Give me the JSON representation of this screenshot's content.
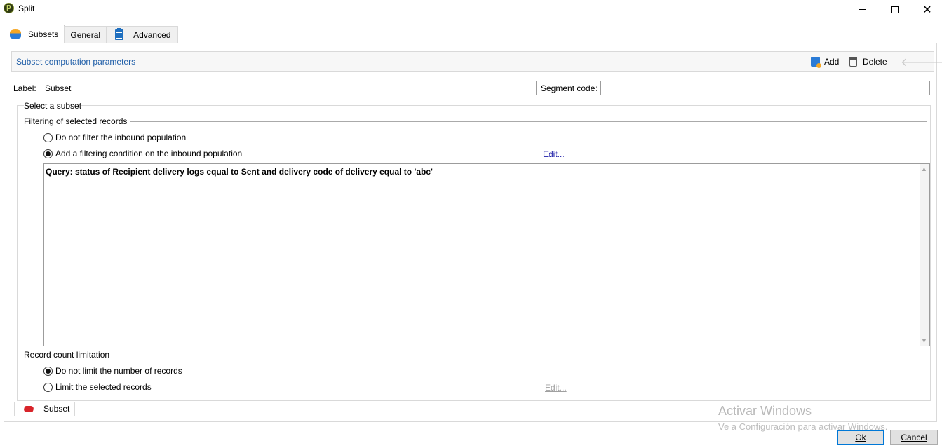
{
  "window": {
    "title": "Split"
  },
  "tabs": [
    {
      "label": "Subsets",
      "icon": "database-icon",
      "active": true
    },
    {
      "label": "General",
      "icon": "",
      "active": false
    },
    {
      "label": "Advanced",
      "icon": "clipboard-icon",
      "active": false
    }
  ],
  "section": {
    "title": "Subset computation parameters",
    "toolbar": {
      "add_label": "Add",
      "delete_label": "Delete"
    }
  },
  "form": {
    "label_caption": "Label:",
    "label_value": "Subset",
    "segment_caption": "Segment code:",
    "segment_value": ""
  },
  "select_subset": {
    "title": "Select a subset",
    "filtering": {
      "title": "Filtering of selected records",
      "option_no_filter": "Do not filter the inbound population",
      "option_add_condition": "Add a filtering condition on the inbound population",
      "selected": "add_condition",
      "edit_link": "Edit...",
      "query": "Query: status of Recipient delivery logs equal to Sent and delivery code of delivery equal to 'abc'"
    },
    "limitation": {
      "title": "Record count limitation",
      "option_no_limit": "Do not limit the number of records",
      "option_limit": "Limit the selected records",
      "selected": "no_limit",
      "edit_link": "Edit..."
    }
  },
  "bottom_tab": {
    "label": "Subset",
    "icon": "eraser-icon"
  },
  "watermark": {
    "title": "Activar Windows",
    "subtitle": "Ve a Configuración para activar Windows."
  },
  "buttons": {
    "ok_label": "Ok",
    "cancel_label": "Cancel"
  },
  "colors": {
    "accent": "#1f5ea8",
    "link": "#1a1aa6",
    "ok_border": "#0078d7"
  }
}
